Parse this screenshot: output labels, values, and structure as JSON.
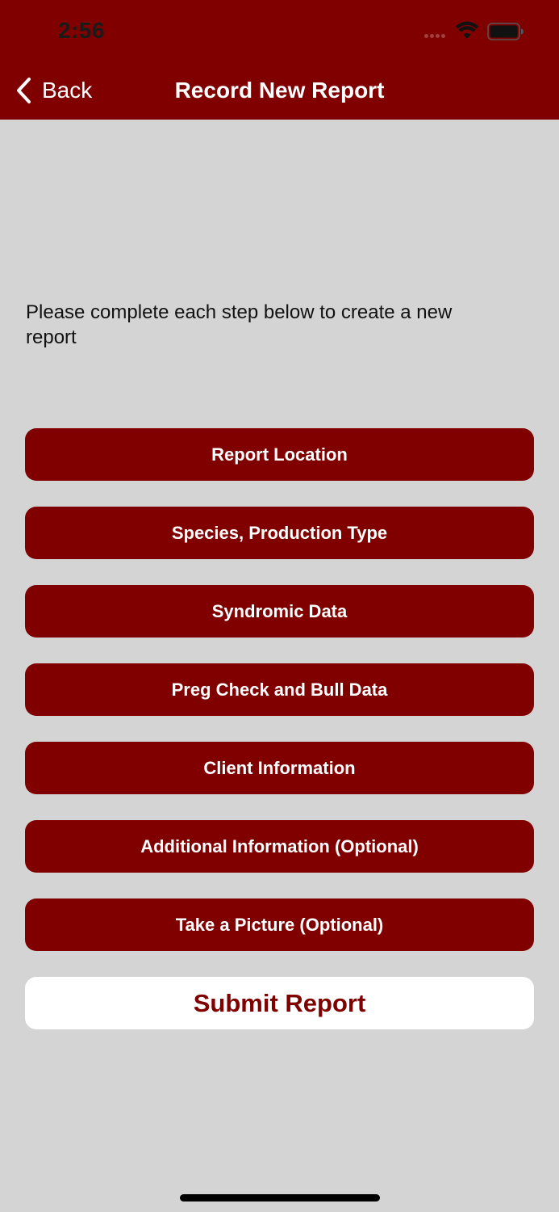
{
  "status_bar": {
    "time": "2:56",
    "icons": [
      "cellular-signal-icon",
      "wifi-icon",
      "battery-icon"
    ]
  },
  "nav": {
    "back_label": "Back",
    "back_icon": "chevron-left-icon",
    "title": "Record New Report"
  },
  "instructions": "Please complete each step below to create a new report",
  "steps": [
    {
      "label": "Report Location"
    },
    {
      "label": "Species, Production Type"
    },
    {
      "label": "Syndromic Data"
    },
    {
      "label": "Preg Check and Bull Data"
    },
    {
      "label": "Client Information"
    },
    {
      "label": "Additional Information (Optional)"
    },
    {
      "label": "Take a Picture (Optional)"
    }
  ],
  "submit_label": "Submit Report",
  "colors": {
    "accent": "#800000",
    "background": "#d4d4d4",
    "button_text": "#ffffff",
    "submit_bg": "#ffffff"
  }
}
